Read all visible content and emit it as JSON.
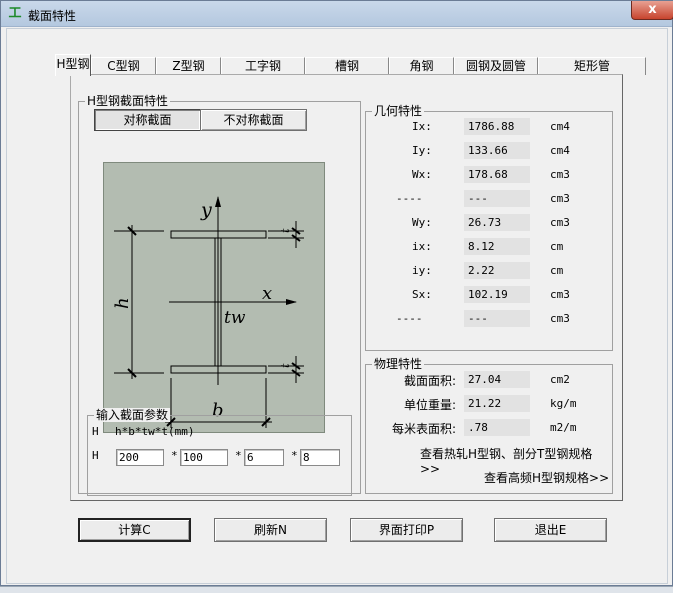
{
  "window": {
    "title": "截面特性",
    "close_glyph": "x"
  },
  "tabs": [
    {
      "label": "H型钢",
      "active": true
    },
    {
      "label": "C型钢"
    },
    {
      "label": "Z型钢"
    },
    {
      "label": "工字钢"
    },
    {
      "label": "槽钢"
    },
    {
      "label": "角钢"
    },
    {
      "label": "圆钢及圆管"
    },
    {
      "label": "矩形管"
    }
  ],
  "section_group": {
    "title": "H型钢截面特性",
    "symmetric_button": "对称截面",
    "asymmetric_button": "不对称截面"
  },
  "diagram": {
    "y_axis": "y",
    "x_axis": "x",
    "height_label": "h",
    "width_label": "b",
    "web_label": "tw",
    "flange_label": "t"
  },
  "input_group": {
    "title": "输入截面参数",
    "row1_prefix": "H",
    "formula": "h*b*tw*t(mm)",
    "row2_prefix": "H",
    "h": "200",
    "b": "100",
    "tw": "6",
    "t": "8",
    "separator": "*"
  },
  "geometry": {
    "title": "几何特性",
    "rows": [
      {
        "label": "Ix:",
        "value": "1786.88",
        "unit": "cm4"
      },
      {
        "label": "Iy:",
        "value": "133.66",
        "unit": "cm4"
      },
      {
        "label": "Wx:",
        "value": "178.68",
        "unit": "cm3"
      },
      {
        "label": "----",
        "value": "---",
        "unit": "cm3"
      },
      {
        "label": "Wy:",
        "value": "26.73",
        "unit": "cm3"
      },
      {
        "label": "ix:",
        "value": "8.12",
        "unit": "cm"
      },
      {
        "label": "iy:",
        "value": "2.22",
        "unit": "cm"
      },
      {
        "label": "Sx:",
        "value": "102.19",
        "unit": "cm3"
      },
      {
        "label": "----",
        "value": "---",
        "unit": "cm3"
      }
    ]
  },
  "physical": {
    "title": "物理特性",
    "rows": [
      {
        "label": "截面面积:",
        "value": "27.04",
        "unit": "cm2"
      },
      {
        "label": "单位重量:",
        "value": "21.22",
        "unit": "kg/m"
      },
      {
        "label": "每米表面积:",
        "value": ".78",
        "unit": "m2/m"
      }
    ],
    "link1": "查看热轧H型钢、剖分T型钢规格>>",
    "link2": "查看高频H型钢规格>>"
  },
  "bottom_buttons": {
    "calc": "计算C",
    "refresh": "刷新N",
    "print": "界面打印P",
    "exit": "退出E"
  }
}
